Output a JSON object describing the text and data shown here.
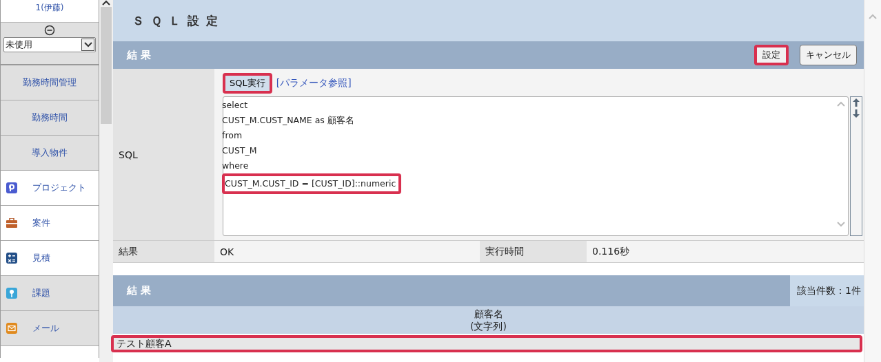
{
  "sidebar": {
    "user": "1(伊藤)",
    "status_select": {
      "value": "未使用"
    },
    "items": [
      {
        "label": "勤務時間管理",
        "kind": "plain",
        "shaded": true
      },
      {
        "label": "勤務時間",
        "kind": "plain",
        "shaded": true
      },
      {
        "label": "導入物件",
        "kind": "plain",
        "shaded": true
      },
      {
        "label": "プロジェクト",
        "kind": "project",
        "shaded": false
      },
      {
        "label": "案件",
        "kind": "case",
        "shaded": false
      },
      {
        "label": "見積",
        "kind": "estimate",
        "shaded": false
      },
      {
        "label": "課題",
        "kind": "issue",
        "shaded": true
      },
      {
        "label": "メール",
        "kind": "mail",
        "shaded": true
      }
    ]
  },
  "page_title": "ＳＱＬ設定",
  "form_section": {
    "title": "結 果",
    "buttons": [
      {
        "label": "設定",
        "highlighted": true
      },
      {
        "label": "キャンセル",
        "highlighted": false
      }
    ]
  },
  "sql_row": {
    "label": "SQL",
    "run_button": {
      "label": "SQL実行",
      "highlighted": true
    },
    "param_link": "[パラメータ参照]",
    "lines": [
      {
        "text": "select",
        "highlighted": false
      },
      {
        "text": "CUST_M.CUST_NAME as 顧客名",
        "highlighted": false
      },
      {
        "text": "from",
        "highlighted": false
      },
      {
        "text": "CUST_M",
        "highlighted": false
      },
      {
        "text": "where",
        "highlighted": false
      },
      {
        "text": "CUST_M.CUST_ID = [CUST_ID]::numeric",
        "highlighted": true
      }
    ]
  },
  "result_row": {
    "label": "結果",
    "value": "OK",
    "time_label": "実行時間",
    "time_value": "0.116秒"
  },
  "results_section": {
    "title": "結 果",
    "count": "該当件数：1件",
    "column": {
      "name": "顧客名",
      "type": "(文字列)"
    },
    "rows": [
      {
        "value": "テスト顧客A",
        "highlighted": true
      }
    ]
  }
}
